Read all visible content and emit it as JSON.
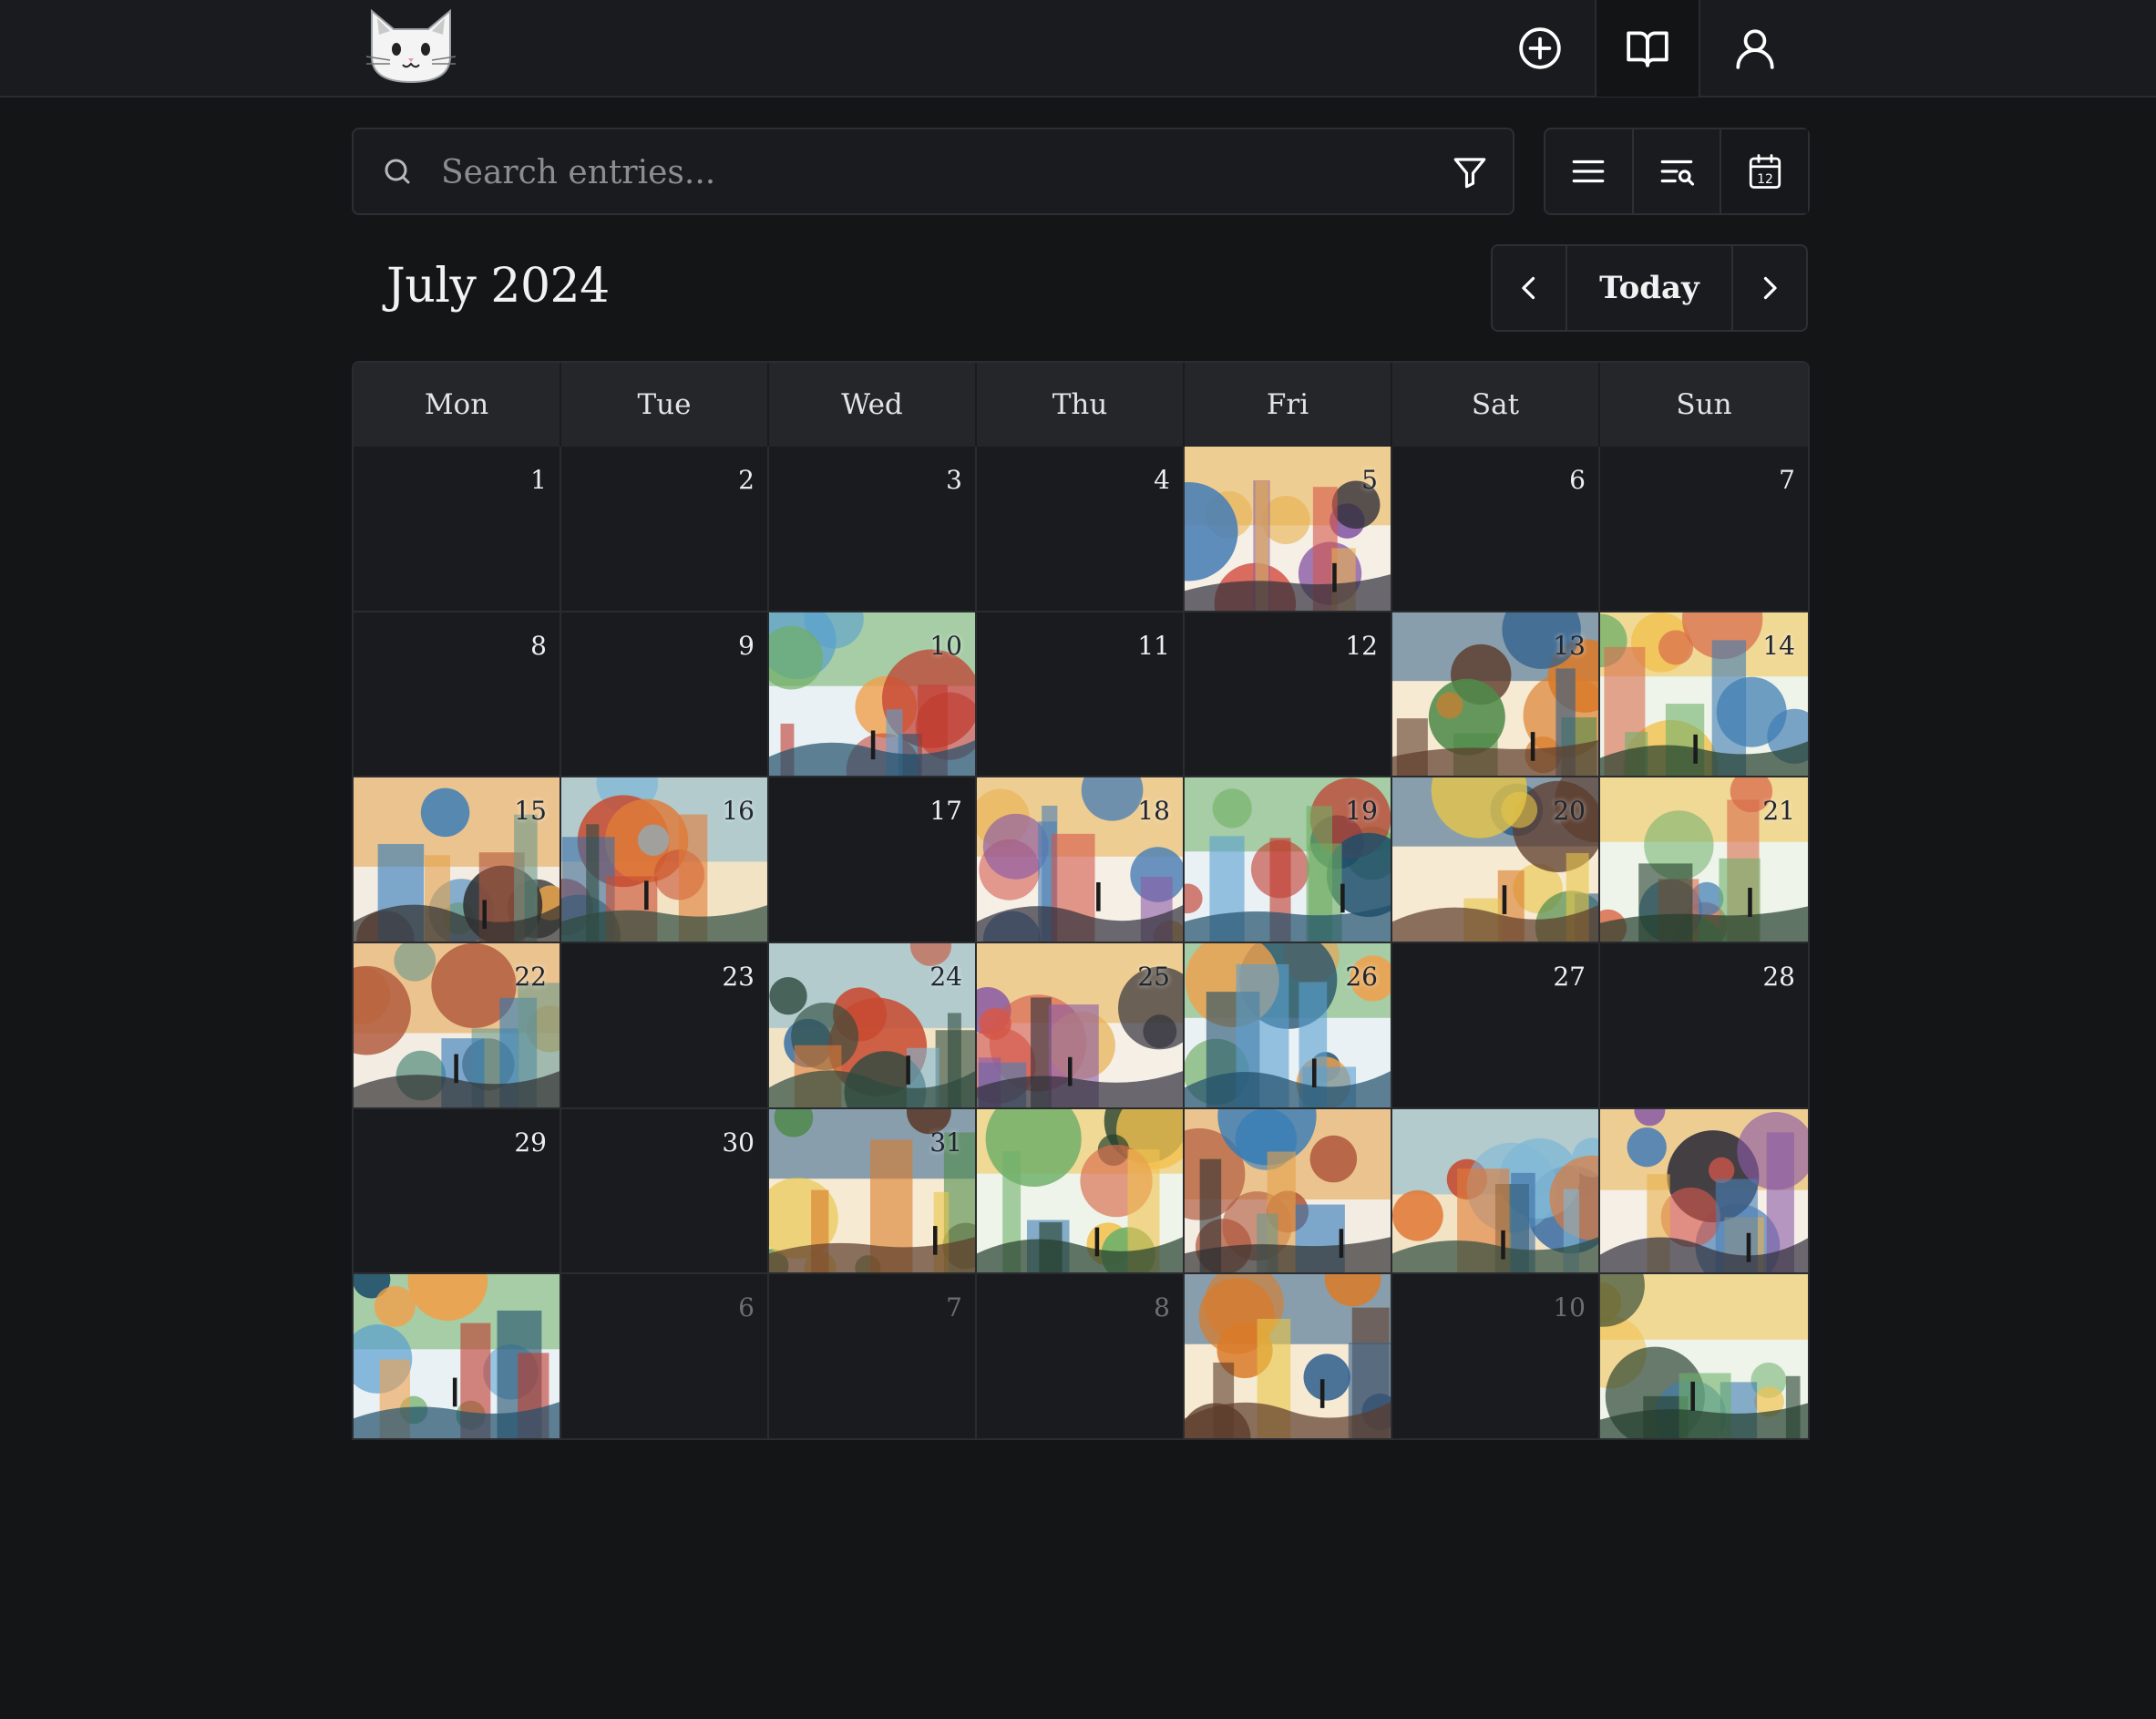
{
  "header": {
    "logo": "cat-face",
    "nav": [
      {
        "name": "new-entry",
        "icon": "plus-circle-icon"
      },
      {
        "name": "journal",
        "icon": "open-book-icon",
        "active": true
      },
      {
        "name": "profile",
        "icon": "user-icon"
      }
    ]
  },
  "search": {
    "placeholder": "Search entries...",
    "value": ""
  },
  "views": [
    {
      "name": "list",
      "icon": "list-icon"
    },
    {
      "name": "search-list",
      "icon": "list-search-icon"
    },
    {
      "name": "calendar",
      "icon": "calendar-icon",
      "badge": "12",
      "active": true
    }
  ],
  "calendar": {
    "title": "July 2024",
    "today_label": "Today",
    "weekdays": [
      "Mon",
      "Tue",
      "Wed",
      "Thu",
      "Fri",
      "Sat",
      "Sun"
    ],
    "days": [
      {
        "n": "1"
      },
      {
        "n": "2"
      },
      {
        "n": "3"
      },
      {
        "n": "4"
      },
      {
        "n": "5",
        "img": 1
      },
      {
        "n": "6"
      },
      {
        "n": "7"
      },
      {
        "n": "8"
      },
      {
        "n": "9"
      },
      {
        "n": "10",
        "img": 2
      },
      {
        "n": "11"
      },
      {
        "n": "12"
      },
      {
        "n": "13",
        "img": 3
      },
      {
        "n": "14",
        "img": 4
      },
      {
        "n": "15",
        "img": 5
      },
      {
        "n": "16",
        "img": 6
      },
      {
        "n": "17"
      },
      {
        "n": "18",
        "img": 7
      },
      {
        "n": "19",
        "img": 8
      },
      {
        "n": "20",
        "img": 9
      },
      {
        "n": "21",
        "img": 10
      },
      {
        "n": "22",
        "img": 11
      },
      {
        "n": "23"
      },
      {
        "n": "24",
        "img": 12
      },
      {
        "n": "25",
        "img": 13
      },
      {
        "n": "26",
        "img": 14
      },
      {
        "n": "27"
      },
      {
        "n": "28"
      },
      {
        "n": "29"
      },
      {
        "n": "30"
      },
      {
        "n": "31",
        "img": 15
      },
      {
        "n": "",
        "img": 16
      },
      {
        "n": "",
        "img": 17
      },
      {
        "n": "",
        "img": 18
      },
      {
        "n": "",
        "img": 19
      },
      {
        "n": "",
        "img": 20
      },
      {
        "n": "6",
        "other": true
      },
      {
        "n": "7",
        "other": true
      },
      {
        "n": "8",
        "other": true
      },
      {
        "n": "",
        "img": 21
      },
      {
        "n": "10",
        "other": true
      },
      {
        "n": "",
        "img": 22
      }
    ]
  },
  "colors": {
    "background": "#141517",
    "surface": "#1a1b1e",
    "header_row": "#24262a",
    "border": "#2b2c30",
    "text": "#e9e9ea",
    "muted": "#6d6e74"
  }
}
